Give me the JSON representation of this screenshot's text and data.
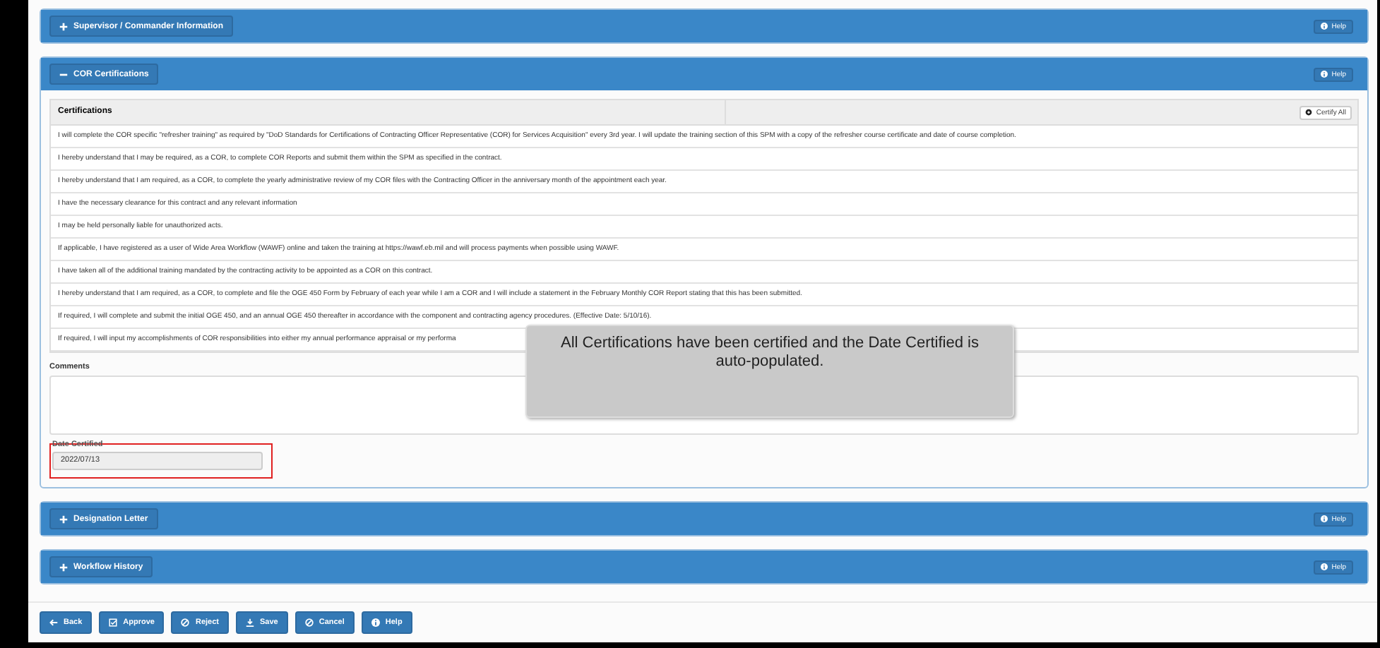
{
  "sections_top": [
    {
      "title": "Supervisor / Commander Information",
      "expanded": false,
      "help": "Help"
    }
  ],
  "cor_section": {
    "title": "COR Certifications",
    "expanded": true,
    "help": "Help",
    "table": {
      "columns": [
        "Certifications"
      ],
      "certify_all": "Certify All",
      "rows": [
        "I will complete the COR specific \"refresher training\" as required by \"DoD Standards for Certifications of Contracting Officer Representative (COR) for Services Acquisition\" every 3rd year. I will update the training section of this SPM with a copy of the refresher course certificate and date of course completion.",
        "I hereby understand that I may be required, as a COR, to complete COR Reports and submit them within the SPM as specified in the contract.",
        "I hereby understand that I am required, as a COR, to complete the yearly administrative review of my COR files with the Contracting Officer in the anniversary month of the appointment each year.",
        "I have the necessary clearance for this contract and any relevant information",
        "I may be held personally liable for unauthorized acts.",
        "If applicable, I have registered as a user of Wide Area Workflow (WAWF) online and taken the training at https://wawf.eb.mil and will process payments when possible using WAWF.",
        "I have taken all of the additional training mandated by the contracting activity to be appointed as a COR on this contract.",
        "I hereby understand that I am required, as a COR, to complete and file the OGE 450 Form by February of each year while I am a COR and I will include a statement in the February Monthly COR Report stating that this has been submitted.",
        "If required, I will complete and submit the initial OGE 450, and an annual OGE 450 thereafter in accordance with the component and contracting agency procedures. (Effective Date: 5/10/16).",
        "If required, I will input my accomplishments of COR responsibilities into either my annual performance appraisal or my performa"
      ]
    },
    "comments_label": "Comments",
    "date_label": "Date Certified",
    "date_value": "2022/07/13"
  },
  "sections_bottom": [
    {
      "title": "Designation Letter",
      "expanded": false,
      "help": "Help"
    },
    {
      "title": "Workflow History",
      "expanded": false,
      "help": "Help"
    }
  ],
  "tooltip": "All Certifications have been certified and the Date Certified is auto-populated.",
  "footer_buttons": [
    {
      "kind": "back",
      "label": "Back"
    },
    {
      "kind": "approve",
      "label": "Approve"
    },
    {
      "kind": "reject",
      "label": "Reject"
    },
    {
      "kind": "save",
      "label": "Save"
    },
    {
      "kind": "cancel",
      "label": "Cancel"
    },
    {
      "kind": "help",
      "label": "Help"
    }
  ]
}
